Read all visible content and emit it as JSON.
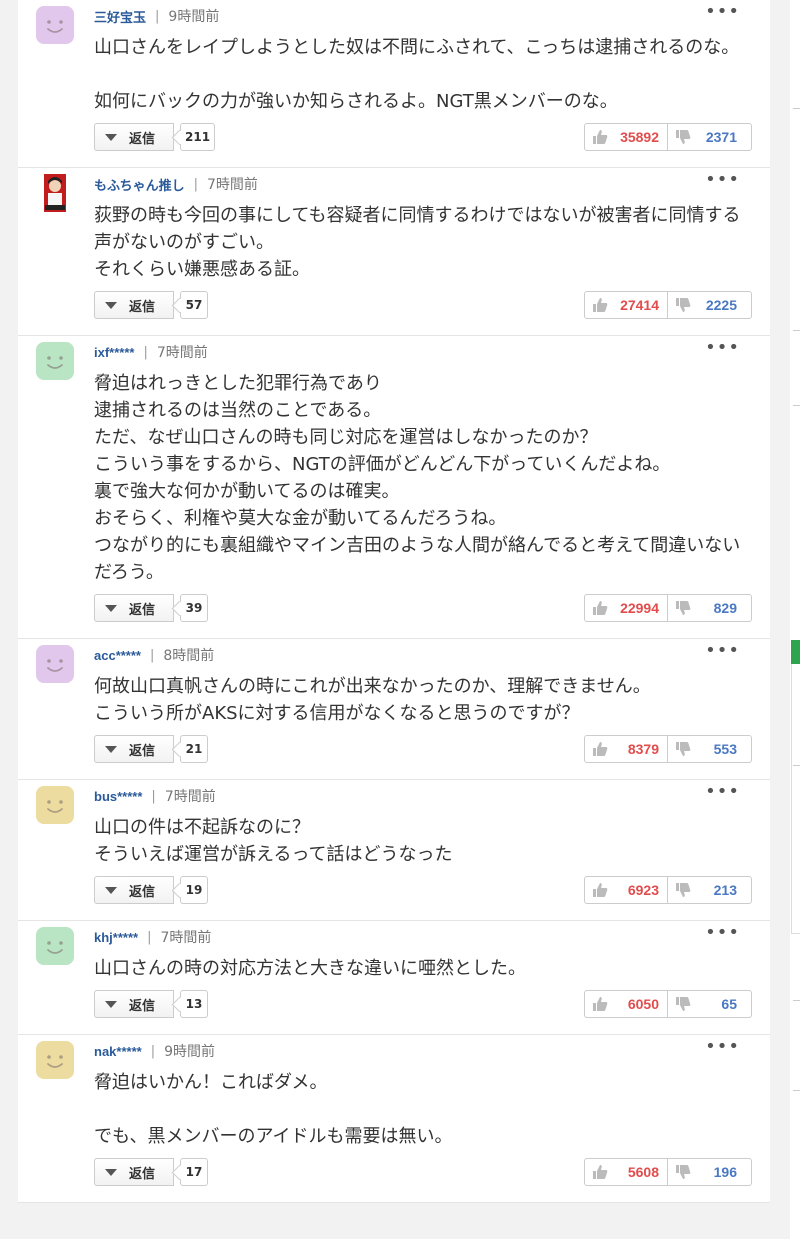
{
  "reply_label": "返信",
  "comments": [
    {
      "user": "三好宝玉",
      "time": "9時間前",
      "text": "山口さんをレイプしようとした奴は不問にふされて、こっちは逮捕されるのな。\n\n如何にバックの力が強いか知らされるよ。NGT黒メンバーのな。",
      "replies": "211",
      "likes": "35892",
      "dislikes": "2371",
      "avatar_color": "#e2c7ec"
    },
    {
      "user": "もふちゃん推し",
      "time": "7時間前",
      "text": "荻野の時も今回の事にしても容疑者に同情するわけではないが被害者に同情する声がないのがすごい。\nそれくらい嫌悪感ある証。",
      "replies": "57",
      "likes": "27414",
      "dislikes": "2225",
      "avatar_color": "photo"
    },
    {
      "user": "ixf*****",
      "time": "7時間前",
      "text": "脅迫はれっきとした犯罪行為であり\n逮捕されるのは当然のことである。\nただ、なぜ山口さんの時も同じ対応を運営はしなかったのか？\nこういう事をするから、NGTの評価がどんどん下がっていくんだよね。\n裏で強大な何かが動いてるのは確実。\nおそらく、利権や莫大な金が動いてるんだろうね。\nつながり的にも裏組織やマイン吉田のような人間が絡んでると考えて間違いないだろう。",
      "replies": "39",
      "likes": "22994",
      "dislikes": "829",
      "avatar_color": "#b9e5c4"
    },
    {
      "user": "acc*****",
      "time": "8時間前",
      "text": "何故山口真帆さんの時にこれが出来なかったのか、理解できません。\nこういう所がAKSに対する信用がなくなると思うのですが？",
      "replies": "21",
      "likes": "8379",
      "dislikes": "553",
      "avatar_color": "#e2c7ec"
    },
    {
      "user": "bus*****",
      "time": "7時間前",
      "text": "山口の件は不起訴なのに？\nそういえば運営が訴えるって話はどうなった",
      "replies": "19",
      "likes": "6923",
      "dislikes": "213",
      "avatar_color": "#ecdca0"
    },
    {
      "user": "khj*****",
      "time": "7時間前",
      "text": "山口さんの時の対応方法と大きな違いに唖然とした。",
      "replies": "13",
      "likes": "6050",
      "dislikes": "65",
      "avatar_color": "#b9e5c4"
    },
    {
      "user": "nak*****",
      "time": "9時間前",
      "text": "脅迫はいかん！こればダメ。\n\nでも、黒メンバーのアイドルも需要は無い。",
      "replies": "17",
      "likes": "5608",
      "dislikes": "196",
      "avatar_color": "#ecdca0"
    }
  ]
}
